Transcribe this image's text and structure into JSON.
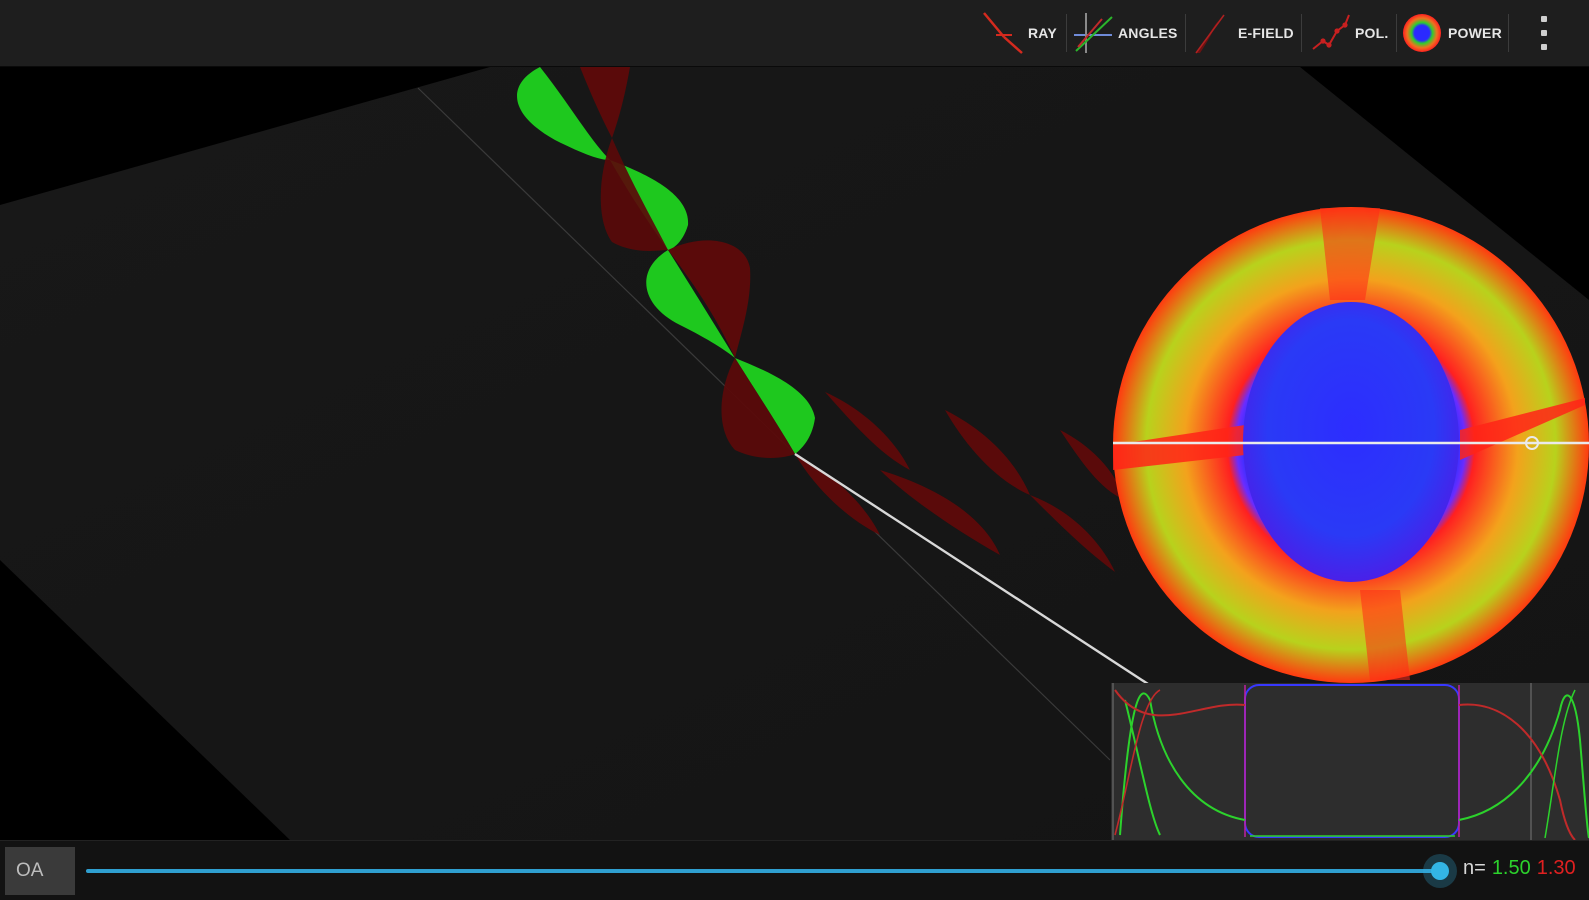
{
  "toolbar": {
    "items": [
      {
        "label": "RAY",
        "icon": "ray-icon"
      },
      {
        "label": "ANGLES",
        "icon": "angles-icon"
      },
      {
        "label": "E-FIELD",
        "icon": "e-field-icon"
      },
      {
        "label": "POL.",
        "icon": "polarization-icon"
      },
      {
        "label": "POWER",
        "icon": "power-icon"
      }
    ],
    "overflow_icon": "more-vert-icon"
  },
  "bottom": {
    "oa_label": "OA",
    "slider_value": 0.98,
    "n_label": "n=",
    "n_ordinary": "1.50",
    "n_extraordinary": "1.30"
  },
  "colors": {
    "ordinary_wave": "#1ec81e",
    "extraordinary_wave": "#5a0a0a",
    "slider_accent": "#33b5e5",
    "toolbar_bg": "#1e1e1e"
  }
}
